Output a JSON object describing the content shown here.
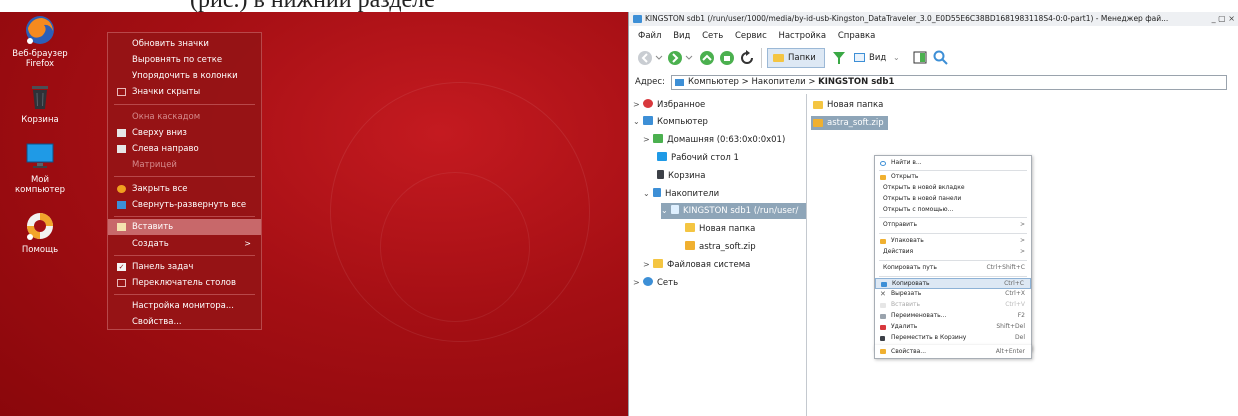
{
  "caption": {
    "text": "(рис.) в нижний разделе"
  },
  "desktop": {
    "icons": [
      {
        "id": "firefox",
        "label": "Веб-браузер Firefox"
      },
      {
        "id": "trash",
        "label": "Корзина"
      },
      {
        "id": "computer",
        "label": "Мой компьютер"
      },
      {
        "id": "help",
        "label": "Помощь"
      }
    ],
    "menu": {
      "refresh": "Обновить значки",
      "align_grid": "Выровнять по сетке",
      "arrange_columns": "Упорядочить в колонки",
      "icons_hidden": "Значки скрыты",
      "cascade_header": "Окна каскадом",
      "top_down": "Сверху вниз",
      "left_right": "Слева направо",
      "matrix": "Матрицей",
      "close_all": "Закрыть все",
      "minmax_all": "Свернуть-развернуть все",
      "paste": "Вставить",
      "create": "Создать",
      "taskbar": "Панель задач",
      "desk_switcher": "Переключатель столов",
      "monitor_settings": "Настройка монитора...",
      "properties": "Свойства..."
    }
  },
  "fm": {
    "title": "KINGSTON sdb1 (/run/user/1000/media/by-id-usb-Kingston_DataTraveler_3.0_E0D55E6C38BD1681983118S4-0:0-part1) - Менеджер фай...",
    "window_controls": "_ ▢ ×",
    "menus": [
      "Файл",
      "Вид",
      "Сеть",
      "Сервис",
      "Настройка",
      "Справка"
    ],
    "toolbar": {
      "folders": "Папки",
      "view": "Вид"
    },
    "address": {
      "label": "Адрес:",
      "crumb1": "Компьютер",
      "crumb2": "Накопители",
      "current": "KINGSTON sdb1"
    },
    "tree": {
      "favorites": "Избранное",
      "computer": "Компьютер",
      "home": "Домашняя (0:63:0x0:0x01)",
      "desktop1": "Рабочий стол 1",
      "trash": "Корзина",
      "drives": "Накопители",
      "kingston": "KINGSTON sdb1 (/run/user/",
      "new_folder": "Новая папка",
      "astra": "astra_soft.zip",
      "filesystem": "Файловая система",
      "network": "Сеть"
    },
    "files": {
      "new_folder": "Новая папка",
      "astra": "astra_soft.zip"
    },
    "context_menu": {
      "find": "Найти в...",
      "open": "Открыть",
      "open_tab": "Открыть в новой вкладке",
      "open_panel": "Открыть в новой панели",
      "open_with": "Открыть с помощью...",
      "send": "Отправить",
      "pack": "Упаковать",
      "actions": "Действия",
      "copy_path": "Копировать путь",
      "copy_path_sc": "Ctrl+Shift+C",
      "copy": "Копировать",
      "copy_sc": "Ctrl+C",
      "cut": "Вырезать",
      "cut_sc": "Ctrl+X",
      "paste": "Вставить",
      "paste_sc": "Ctrl+V",
      "rename": "Переименовать...",
      "rename_sc": "F2",
      "delete": "Удалить",
      "delete_sc": "Shift+Del",
      "move_trash": "Переместить в Корзину",
      "move_trash_sc": "Del",
      "properties": "Свойства...",
      "properties_sc": "Alt+Enter"
    }
  },
  "colors": {
    "desktop_red": "#a50f14",
    "menu_red": "#96141a",
    "menu_highlight": "#c8686a",
    "selection": "#8ea5b8",
    "accent_blue": "#3d8fd6"
  }
}
